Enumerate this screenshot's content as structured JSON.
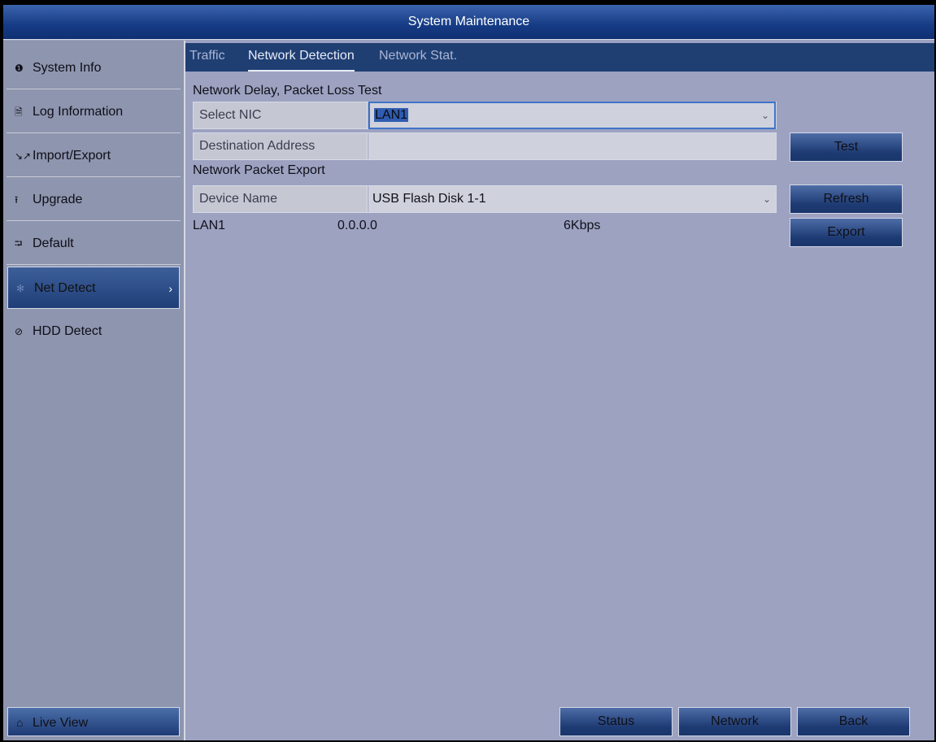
{
  "title": "System Maintenance",
  "sidebar": {
    "items": [
      {
        "label": "System Info",
        "icon": "info-icon",
        "glyph": "❶"
      },
      {
        "label": "Log Information",
        "icon": "log-icon",
        "glyph": "🗎"
      },
      {
        "label": "Import/Export",
        "icon": "import-export-icon",
        "glyph": "↘↗"
      },
      {
        "label": "Upgrade",
        "icon": "upgrade-icon",
        "glyph": "⭱"
      },
      {
        "label": "Default",
        "icon": "default-icon",
        "glyph": "⮒"
      },
      {
        "label": "Net Detect",
        "icon": "net-detect-icon",
        "glyph": "✻"
      },
      {
        "label": "HDD Detect",
        "icon": "hdd-detect-icon",
        "glyph": "⊘"
      }
    ],
    "active_index": 5,
    "chevron": "›",
    "live_view": {
      "label": "Live View",
      "glyph": "⌂"
    }
  },
  "tabs": [
    {
      "label": "Traffic"
    },
    {
      "label": "Network Detection"
    },
    {
      "label": "Network Stat."
    }
  ],
  "delay_test": {
    "title": "Network Delay, Packet Loss Test",
    "nic_label": "Select NIC",
    "nic_value": "LAN1",
    "dest_label": "Destination Address",
    "dest_value": "",
    "test_button": "Test"
  },
  "packet_export": {
    "title": "Network Packet Export",
    "device_label": "Device Name",
    "device_value": "USB Flash Disk 1-1",
    "refresh_button": "Refresh",
    "export_button": "Export",
    "interface": {
      "name": "LAN1",
      "ip": "0.0.0.0",
      "rate": "6Kbps"
    }
  },
  "footer": {
    "status": "Status",
    "network": "Network",
    "back": "Back"
  },
  "colors": {
    "title_bar": "#163b85",
    "background": "#9da2c1",
    "sidebar": "#8e95ae",
    "tab_bar": "#1f3f73"
  }
}
